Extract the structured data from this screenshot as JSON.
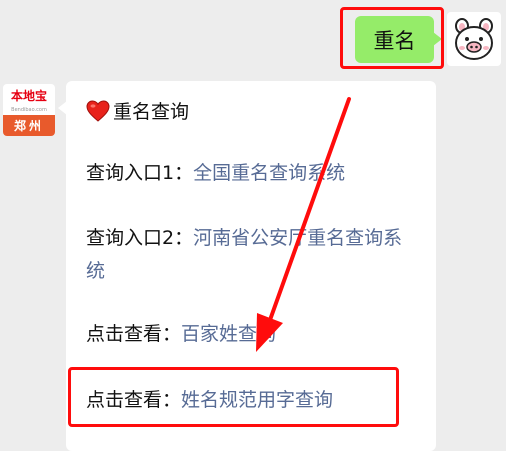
{
  "user_message": {
    "text": "重名"
  },
  "bot_avatar": {
    "logo_text": "本地宝",
    "logo_url": "Bendibao.com",
    "city": "郑州"
  },
  "bot_message": {
    "title": "重名查询",
    "lines": [
      {
        "prefix": "查询入口1：",
        "link": "全国重名查询系统"
      },
      {
        "prefix": "查询入口2：",
        "link": "河南省公安厅重名查询系统"
      },
      {
        "prefix": "点击查看：",
        "link": "百家姓查询"
      },
      {
        "prefix": "点击查看：",
        "link": "姓名规范用字查询"
      }
    ]
  },
  "colors": {
    "background": "#ededed",
    "user_bubble": "#95ec69",
    "bot_bubble": "#ffffff",
    "link": "#576b95",
    "highlight": "#ff0c0c",
    "brand": "#e85a2c"
  },
  "icons": {
    "title_icon": "heart-icon",
    "user_avatar": "pig-face-icon"
  }
}
